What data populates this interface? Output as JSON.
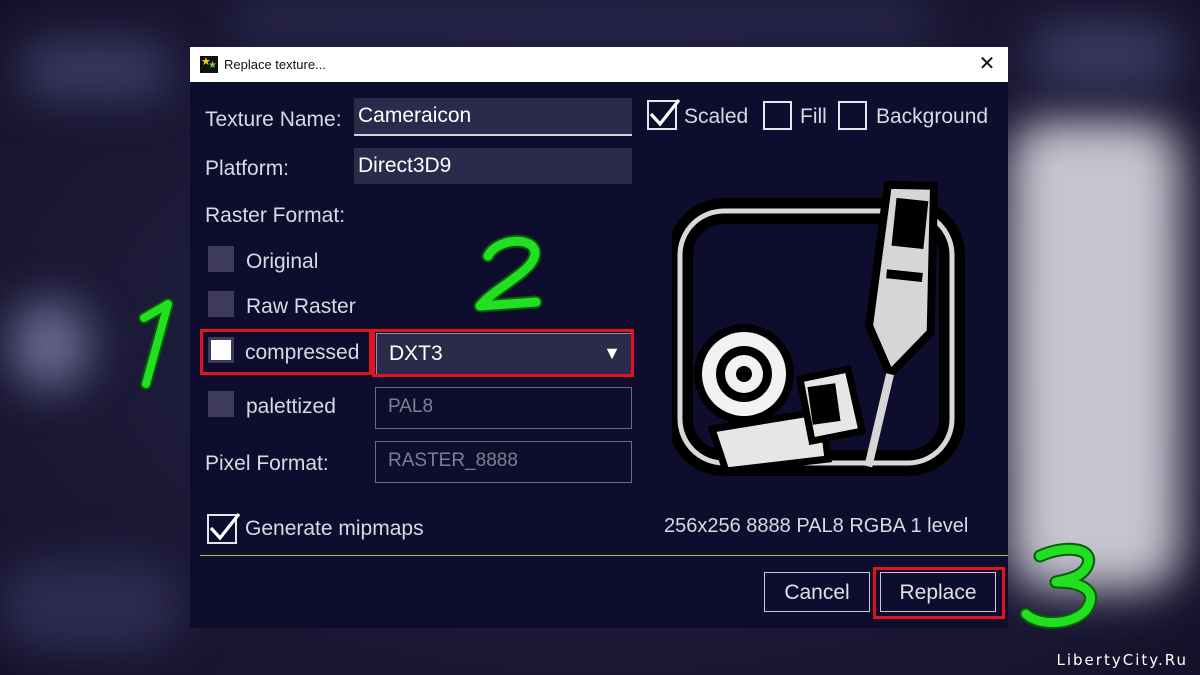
{
  "window": {
    "title": "Replace texture..."
  },
  "fields": {
    "texture_name": {
      "label": "Texture Name:",
      "value": "Cameraicon"
    },
    "platform": {
      "label": "Platform:",
      "value": "Direct3D9"
    },
    "raster_format_label": "Raster Format:",
    "pixel_format": {
      "label": "Pixel Format:",
      "value": "RASTER_8888"
    }
  },
  "raster_options": {
    "original": "Original",
    "raw_raster": "Raw Raster",
    "compressed": "compressed",
    "palettized": "palettized"
  },
  "compression_select": {
    "value": "DXT3"
  },
  "palette_select": {
    "value": "PAL8"
  },
  "view_options": {
    "scaled": {
      "label": "Scaled",
      "checked": true
    },
    "fill": {
      "label": "Fill",
      "checked": false
    },
    "background": {
      "label": "Background",
      "checked": false
    }
  },
  "mipmaps": {
    "label": "Generate mipmaps",
    "checked": true
  },
  "texture_info": "256x256 8888 PAL8 RGBA 1 level",
  "buttons": {
    "cancel": "Cancel",
    "replace": "Replace"
  },
  "annotations": [
    "1",
    "2",
    "3"
  ],
  "watermark": "LibertyCity.Ru",
  "colors": {
    "dialog_bg": "#0f0d2e",
    "highlight": "#e0141f",
    "annotation": "#21e021"
  }
}
